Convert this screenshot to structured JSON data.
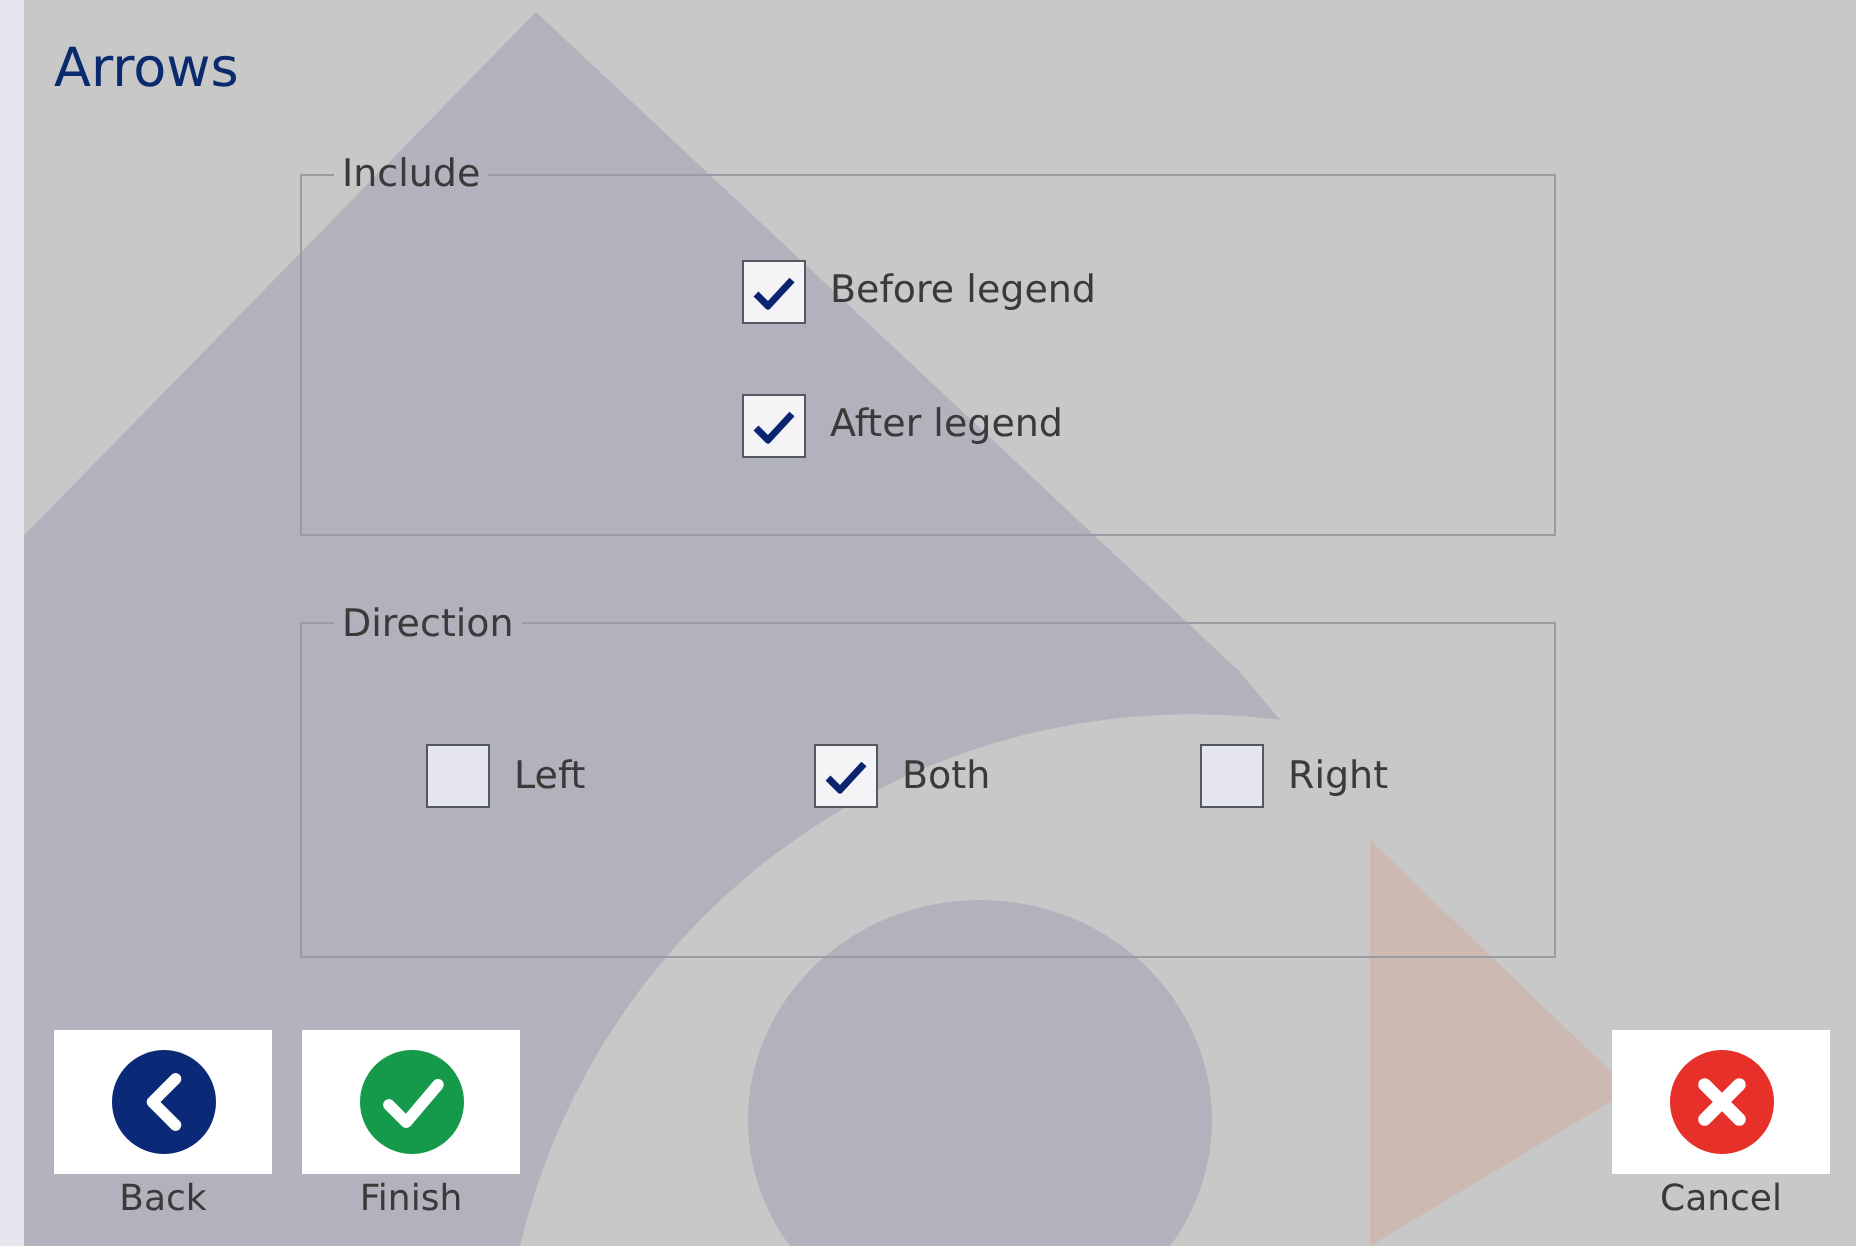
{
  "title": "Arrows",
  "groups": [
    {
      "legend": "Include",
      "kind": "column",
      "options": [
        {
          "label": "Before legend",
          "checked": true
        },
        {
          "label": "After legend",
          "checked": true
        }
      ]
    },
    {
      "legend": "Direction",
      "kind": "row",
      "options": [
        {
          "label": "Left",
          "checked": false
        },
        {
          "label": "Both",
          "checked": true
        },
        {
          "label": "Right",
          "checked": false
        }
      ]
    }
  ],
  "buttons": [
    {
      "label": "Back",
      "kind": "back"
    },
    {
      "label": "Finish",
      "kind": "finish"
    },
    {
      "label": "Cancel",
      "kind": "cancel"
    }
  ]
}
